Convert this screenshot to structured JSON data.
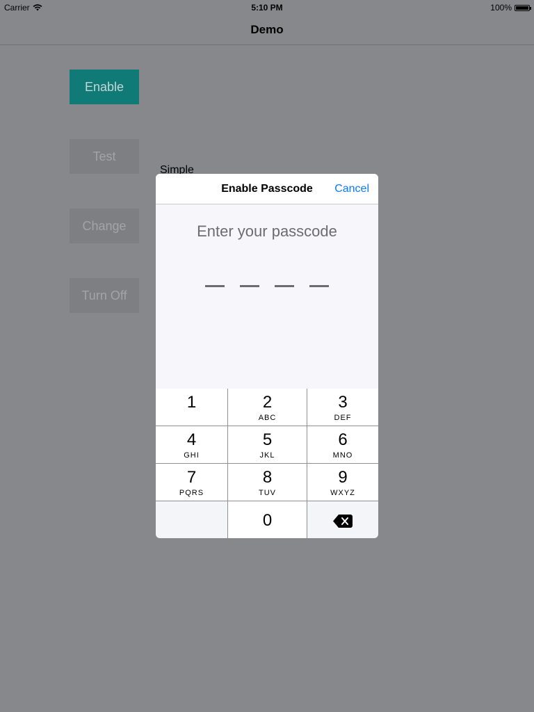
{
  "status": {
    "carrier": "Carrier",
    "time": "5:10 PM",
    "battery": "100%",
    "battery_level": 1.0
  },
  "nav": {
    "title": "Demo"
  },
  "buttons": {
    "enable": "Enable",
    "test": "Test",
    "change": "Change",
    "turn_off": "Turn Off"
  },
  "simple_label": "Simple",
  "modal": {
    "title": "Enable Passcode",
    "cancel": "Cancel",
    "prompt": "Enter your passcode"
  },
  "keypad": [
    {
      "num": "1",
      "letters": ""
    },
    {
      "num": "2",
      "letters": "ABC"
    },
    {
      "num": "3",
      "letters": "DEF"
    },
    {
      "num": "4",
      "letters": "GHI"
    },
    {
      "num": "5",
      "letters": "JKL"
    },
    {
      "num": "6",
      "letters": "MNO"
    },
    {
      "num": "7",
      "letters": "PQRS"
    },
    {
      "num": "8",
      "letters": "TUV"
    },
    {
      "num": "9",
      "letters": "WXYZ"
    },
    {
      "num": "0",
      "letters": ""
    }
  ],
  "colors": {
    "accent": "#0a7aff",
    "enable_bg": "#0f7a76",
    "overlay": "#87888c"
  }
}
